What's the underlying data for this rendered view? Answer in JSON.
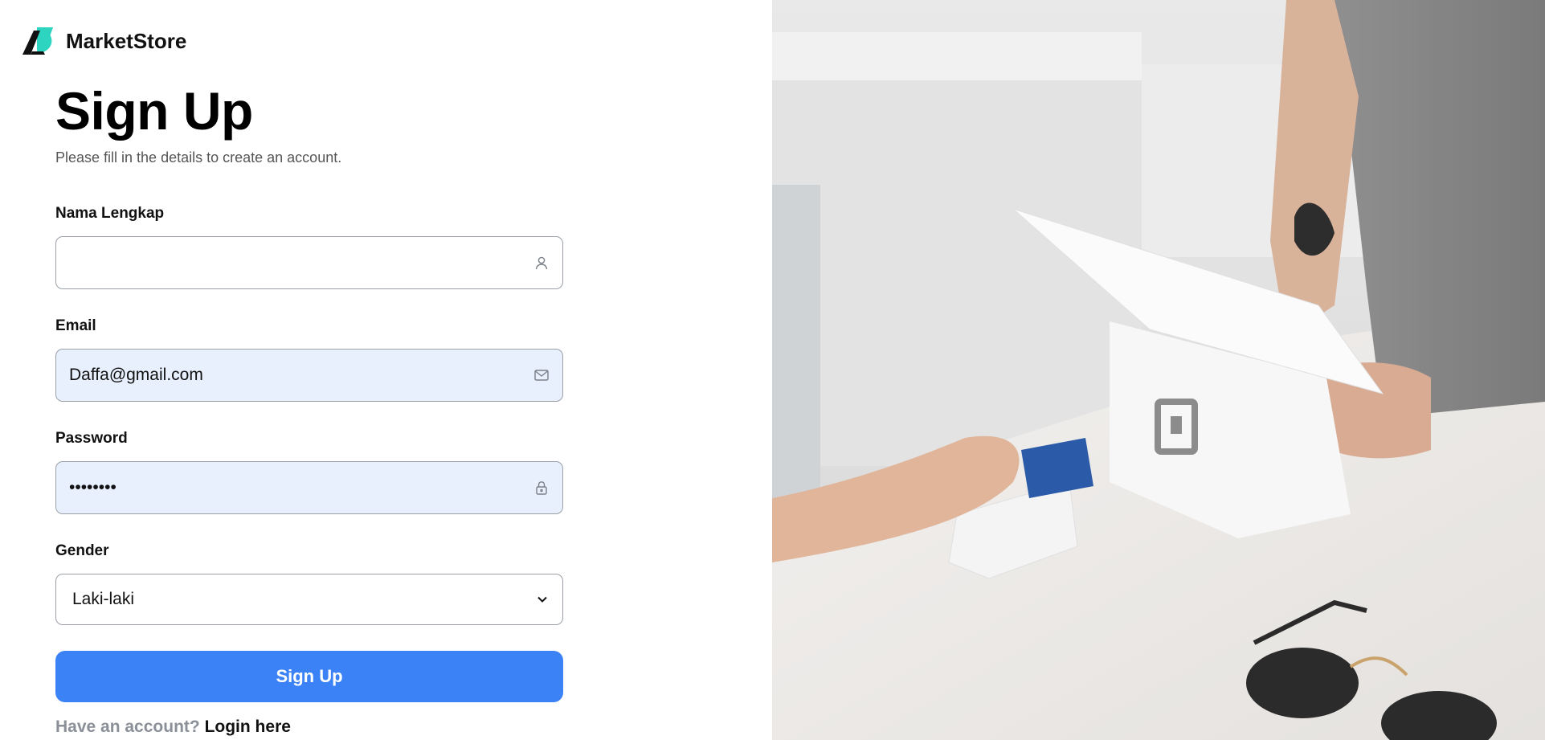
{
  "brand": {
    "name": "MarketStore",
    "accent": "#2dd4bf"
  },
  "form": {
    "title": "Sign Up",
    "subtitle": "Please fill in the details to create an account.",
    "fields": {
      "full_name": {
        "label": "Nama Lengkap",
        "value": "",
        "icon": "user-icon"
      },
      "email": {
        "label": "Email",
        "value": "Daffa@gmail.com",
        "icon": "mail-icon"
      },
      "password": {
        "label": "Password",
        "value": "••••••••",
        "icon": "lock-icon"
      },
      "gender": {
        "label": "Gender",
        "selected": "Laki-laki"
      }
    },
    "submit_label": "Sign Up",
    "footer": {
      "prompt": "Have an account?",
      "link_label": "Login here"
    }
  },
  "colors": {
    "primary": "#3b82f6",
    "autofill": "#e8f0fe"
  }
}
